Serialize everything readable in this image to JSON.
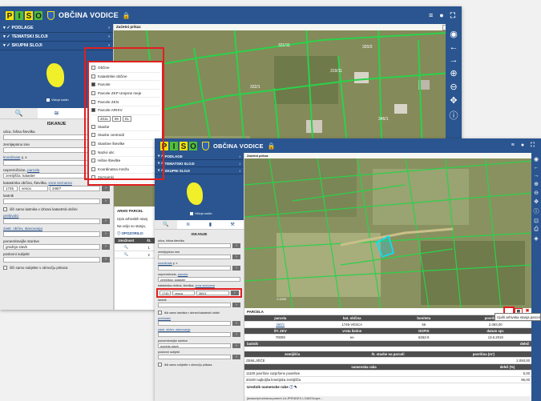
{
  "app": {
    "logo": [
      "P",
      "I",
      "S",
      "O"
    ],
    "title": "OBČINA VODICE"
  },
  "sidebar": {
    "accordion": [
      "PODLAGE",
      "TEMATSKI SLOJI",
      "SKUPNI SLOJI"
    ],
    "minimap_label": "Vklopi način",
    "section_title": "ISKANJE",
    "fields": {
      "ulica_label": "ulica, hišna številka",
      "zemljepisno_label": "zemljepisno ime",
      "koordinate_label": "koordinate",
      "koordinate_suffix": "y, x",
      "nepremicnine_label": "nepremičnine,",
      "nepremicnine_link": "parcela",
      "nepremicnine_value": "zemljišča: kataster",
      "katastrska_label": "katastrska občina, številka,",
      "katastrska_link": "vnos seznama",
      "ko_code": "1745",
      "ko_name": "vesca",
      "parcel_no_w1": "348/7",
      "parcel_no_w2": "360/1",
      "lastnik_label": "lastnik",
      "samo_lastnika": "išči samo lastnika v izbrani katastrski občini",
      "prebivalci_label": "prebivalci",
      "zavarovanec_label": "zastr. občev, stanovanja",
      "pomembnejse_label": "pomembnejše storitve",
      "pomembnejse_value": "gradnja stavb",
      "poslovni_label": "poslovni subjekt",
      "samo_subjekte": "išči samo subjekte v območju prikaza"
    }
  },
  "map": {
    "header": "Začetni prikaz",
    "header_right": "opis",
    "logo_text": "PISO - VODICE",
    "scale": "1:1000"
  },
  "layers_panel": {
    "items": [
      {
        "label": "Občine",
        "checked": false
      },
      {
        "label": "Katastrske občine",
        "checked": false
      },
      {
        "label": "Parcele",
        "checked": true
      },
      {
        "label": "Parcele ZKP Urejene meje",
        "checked": false
      },
      {
        "label": "Parcele ZKN",
        "checked": false
      },
      {
        "label": "Parcele ARHIV",
        "checked": true
      },
      {
        "label": "Stavbe",
        "checked": false
      },
      {
        "label": "Stavbe centroidi",
        "checked": false
      },
      {
        "label": "Stavbne številke",
        "checked": false
      },
      {
        "label": "Nazivi ulic",
        "checked": false
      },
      {
        "label": "Hišne številke",
        "checked": false
      },
      {
        "label": "Koordinatna mreža",
        "checked": false
      },
      {
        "label": "Zaznamki",
        "checked": false
      }
    ],
    "year": "2011",
    "month": "09",
    "day": "01"
  },
  "arhiv": {
    "title": "ARHIV PARCEL",
    "text1": "Izpis arhivskih stanj",
    "text2": "Na voljo so stanja,",
    "opozorilo": "OPOZORILO:",
    "col1": "zmožnost",
    "col2": "št.",
    "rows": [
      "1",
      "2"
    ]
  },
  "detail": {
    "title": "PARCELA",
    "headers": [
      "parcela",
      "kat. občina",
      "boniteta",
      "površina (m²)"
    ],
    "row": [
      "360/1",
      "1745-VESCA",
      "56",
      "2.093,00"
    ],
    "headers2": [
      "ŠT. ZKV",
      "vrsta listine",
      "DOPIS",
      "datum spr."
    ],
    "row2": [
      "70009",
      "ee",
      "6262-0",
      "13.6.2019"
    ],
    "lastnik_hdr": "lastnik",
    "delez_hdr": "delež",
    "headers3": [
      "zemljišča",
      "št. stavbe na parceli",
      "površina (m²)"
    ],
    "row3": [
      "ZEMLJIŠČE",
      "",
      "2.093,00"
    ],
    "namenska_hdr": "namenska raba",
    "delez_m_hdr": "delež (%)",
    "namenska_rows": [
      {
        "name": "11100 površine razpršene poselitve",
        "value": "5,00"
      },
      {
        "name": "20100 najboljša kmetijska zemljišča",
        "value": "95,00"
      }
    ],
    "urednik": "Urednik namenske rabe",
    "url": "javascript:window.parent.ULJPENDEX.LOADScope...",
    "tooltip": "Izpiši arhivska stanja parcele",
    "mouse": "1:1000"
  }
}
